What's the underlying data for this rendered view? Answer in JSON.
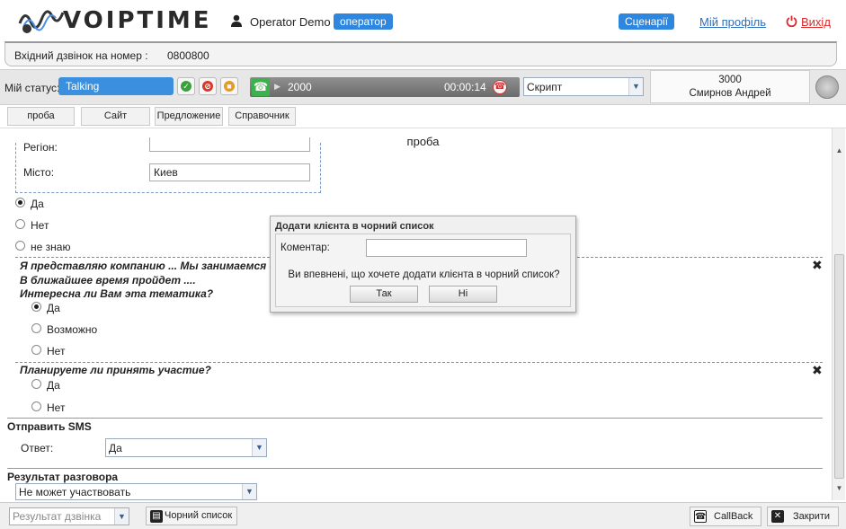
{
  "header": {
    "logo_text": "VOIPTIME",
    "user_name": "Operator Demo",
    "role": "оператор",
    "scenarios": "Сценарії",
    "profile": "Мій профіль",
    "logout": "Вихід"
  },
  "incoming": {
    "label": "Вхідний дзвінок на номер :",
    "number": "0800800"
  },
  "statusbar": {
    "label": "Мій статус:",
    "status": "Talking",
    "call_number": "2000",
    "call_timer": "00:00:14",
    "script": "Скрипт",
    "agent_ext": "3000",
    "agent_name": "Смирнов Андрей"
  },
  "tabs": [
    "проба",
    "Сайт",
    "Предложение",
    "Справочник"
  ],
  "script": {
    "title": "проба",
    "region_label": "Регіон:",
    "city_label": "Місто:",
    "city_value": "Киев",
    "radios1": [
      {
        "label": "Да",
        "checked": true
      },
      {
        "label": "Нет",
        "checked": false
      },
      {
        "label": "не знаю",
        "checked": false
      }
    ],
    "q1_line1": "Я представляю компанию ... Мы занимаемся ор",
    "q1_line2": "В ближайшее время пройдет ....",
    "q1_line3": "Интересна ли Вам эта тематика?",
    "radios2": [
      {
        "label": "Да",
        "checked": true
      },
      {
        "label": "Возможно",
        "checked": false
      },
      {
        "label": "Нет",
        "checked": false
      }
    ],
    "q2": "Планируете ли принять участие?",
    "radios3": [
      {
        "label": "Да",
        "checked": false
      },
      {
        "label": "Нет",
        "checked": false
      }
    ],
    "sms_section": "Отправить SMS",
    "answer_label": "Ответ:",
    "answer_value": "Да",
    "result_section": "Результат разговора",
    "result_value": "Не может участвовать"
  },
  "dialog": {
    "title": "Додати клієнта в чорний список",
    "comment_label": "Коментар:",
    "question": "Ви впевнені, що хочете додати клієнта в чорний список?",
    "yes": "Так",
    "no": "Ні"
  },
  "bottombar": {
    "result_placeholder": "Результат дзвінка",
    "blacklist": "Чорний список",
    "callback": "CallBack",
    "close": "Закрити"
  },
  "colors": {
    "accent": "#2e86de",
    "status": "#3a8fde",
    "logout": "#d72b2b"
  }
}
